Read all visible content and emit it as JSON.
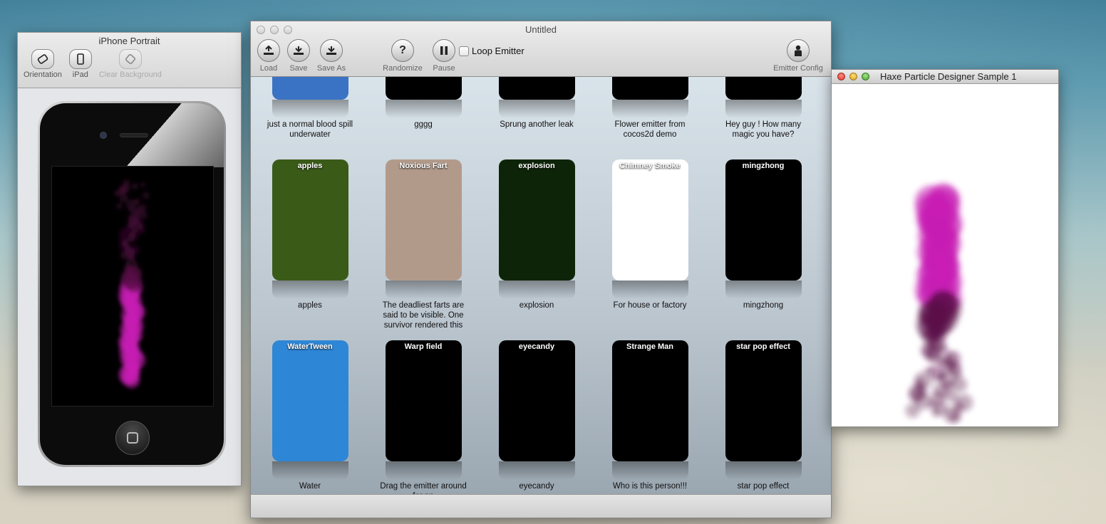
{
  "iphone_window": {
    "title": "iPhone Portrait",
    "tools": [
      {
        "label": "Orientation",
        "icon": "orientation-icon",
        "enabled": true
      },
      {
        "label": "iPad",
        "icon": "ipad-icon",
        "enabled": true
      },
      {
        "label": "Clear Background",
        "icon": "clear-background-icon",
        "enabled": false
      }
    ]
  },
  "main_window": {
    "title": "Untitled",
    "toolbar": {
      "load": "Load",
      "save": "Save",
      "save_as": "Save As",
      "randomize": "Randomize",
      "pause": "Pause",
      "loop_emitter": "Loop Emitter",
      "loop_checked": false,
      "emitter_config": "Emitter Config"
    },
    "gallery_rows": [
      [
        {
          "title": "",
          "caption": "just a normal blood spill underwater",
          "bg": "#3b73c4"
        },
        {
          "title": "",
          "caption": "gggg",
          "bg": "#000000"
        },
        {
          "title": "",
          "caption": "Sprung another leak",
          "bg": "#000000"
        },
        {
          "title": "",
          "caption": "Flower emitter from cocos2d demo",
          "bg": "#000000"
        },
        {
          "title": "",
          "caption": "Hey guy ! How many magic you have?",
          "bg": "#000000"
        }
      ],
      [
        {
          "title": "apples",
          "caption": "apples",
          "bg": "#3a5a18"
        },
        {
          "title": "Noxious Fart",
          "caption": "The deadliest farts are said to be visible. One survivor rendered this after",
          "bg": "#b29a8a"
        },
        {
          "title": "explosion",
          "caption": "explosion",
          "bg": "#0e2408"
        },
        {
          "title": "Chimney Smoke",
          "caption": "For house or factory",
          "bg": "#ffffff"
        },
        {
          "title": "mingzhong",
          "caption": "mingzhong",
          "bg": "#000000"
        }
      ],
      [
        {
          "title": "WaterTween",
          "caption": "Water",
          "bg": "#2e86d6"
        },
        {
          "title": "Warp field",
          "caption": "Drag the emitter around for an",
          "bg": "#000000"
        },
        {
          "title": "eyecandy",
          "caption": "eyecandy",
          "bg": "#000000"
        },
        {
          "title": "Strange Man",
          "caption": "Who is this person!!!",
          "bg": "#000000"
        },
        {
          "title": "star pop effect",
          "caption": "star pop effect",
          "bg": "#000000"
        }
      ]
    ]
  },
  "haxe_window": {
    "title": "Haxe Particle Designer Sample 1"
  },
  "colors": {
    "particle": "#c81fb4",
    "particle_dark": "#5a1048"
  }
}
